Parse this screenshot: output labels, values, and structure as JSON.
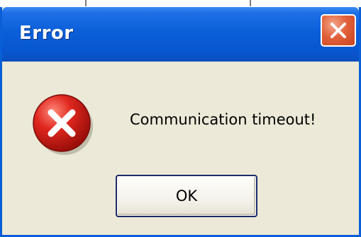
{
  "dialog": {
    "title": "Error",
    "message": "Communication timeout!",
    "ok_label": "OK",
    "icon": "error-icon",
    "close_icon": "close-icon"
  },
  "colors": {
    "titlebar": "#0a5fd8",
    "body": "#ece9d8",
    "close_button": "#e2613a",
    "error_icon": "#d9241c"
  }
}
